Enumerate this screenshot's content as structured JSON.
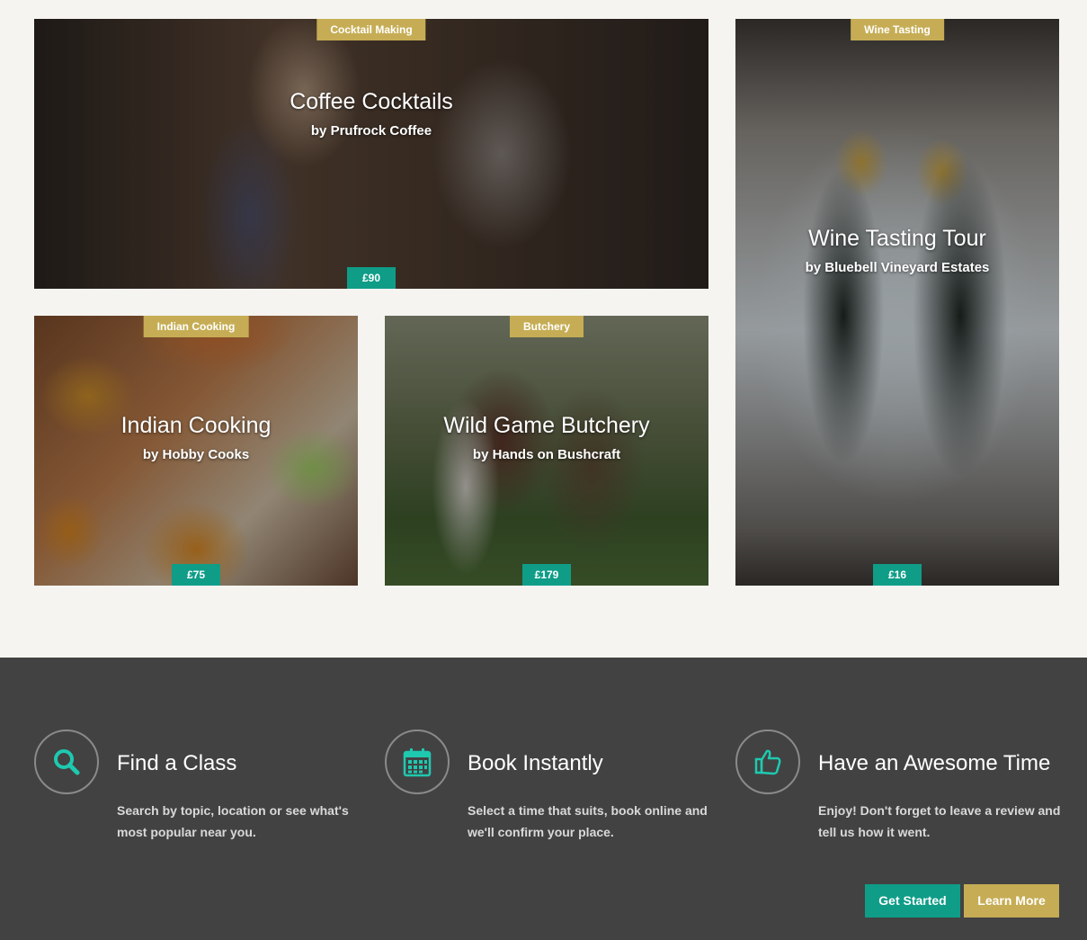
{
  "cards": [
    {
      "category": "Cocktail Making",
      "title": "Coffee Cocktails",
      "by": "by Prufrock Coffee",
      "price": "£90"
    },
    {
      "category": "Wine Tasting",
      "title": "Wine Tasting Tour",
      "by": "by Bluebell Vineyard Estates",
      "price": "£16"
    },
    {
      "category": "Indian Cooking",
      "title": "Indian Cooking",
      "by": "by Hobby Cooks",
      "price": "£75"
    },
    {
      "category": "Butchery",
      "title": "Wild Game Butchery",
      "by": "by Hands on Bushcraft",
      "price": "£179"
    }
  ],
  "features": [
    {
      "icon": "search-icon",
      "title": "Find a Class",
      "text": "Search by topic, location or see what's most popular near you."
    },
    {
      "icon": "calendar-icon",
      "title": "Book Instantly",
      "text": "Select a time that suits, book online and we'll confirm your place."
    },
    {
      "icon": "thumbs-up-icon",
      "title": "Have an Awesome Time",
      "text": "Enjoy! Don't forget to leave a review and tell us how it went."
    }
  ],
  "buttons": {
    "get_started": "Get Started",
    "learn_more": "Learn More"
  },
  "colors": {
    "accent_teal": "#0f9d88",
    "accent_gold": "#c6ad55",
    "footer_bg": "#424242",
    "icon_teal": "#1ec9b0"
  }
}
